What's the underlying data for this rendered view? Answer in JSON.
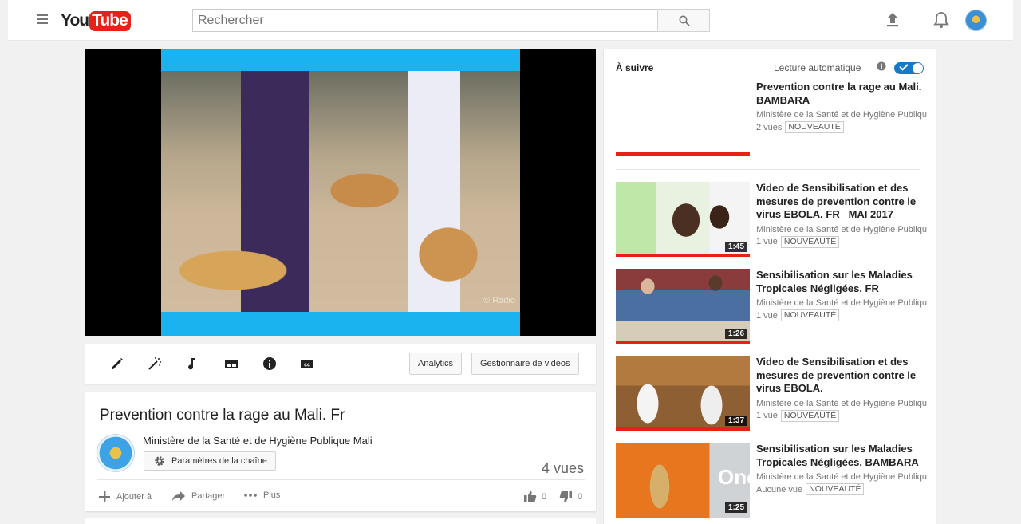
{
  "masthead": {
    "logo_you": "You",
    "logo_tube": "Tube",
    "search_placeholder": "Rechercher"
  },
  "player": {
    "watermark": "© Radio"
  },
  "toolbar": {
    "analytics_label": "Analytics",
    "video_manager_label": "Gestionnaire de vidéos"
  },
  "video": {
    "title": "Prevention contre la rage au Mali. Fr",
    "owner": "Ministère de la Santé et de Hygiène Publique Mali",
    "settings_label": "Paramètres de la chaîne",
    "views": "4 vues",
    "add_to": "Ajouter à",
    "share": "Partager",
    "more": "Plus",
    "likes": "0",
    "dislikes": "0"
  },
  "sidebar": {
    "up_next": "À suivre",
    "autoplay_label": "Lecture automatique",
    "autoplay_on": true,
    "videos": [
      {
        "title": "Prevention contre la rage au Mali. BAMBARA",
        "channel": "Ministère de la Santé et de Hygiène Publiqu",
        "views": "2 vues",
        "badge": "NOUVEAUTÉ",
        "duration": ""
      },
      {
        "title": "Video de Sensibilisation et des mesures de prevention contre le virus EBOLA. FR _MAI 2017",
        "channel": "Ministère de la Santé et de Hygiène Publiqu",
        "views": "1 vue",
        "badge": "NOUVEAUTÉ",
        "duration": "1:45"
      },
      {
        "title": "Sensibilisation sur les Maladies Tropicales Négligées. FR",
        "channel": "Ministère de la Santé et de Hygiène Publiqu",
        "views": "1 vue",
        "badge": "NOUVEAUTÉ",
        "duration": "1:26"
      },
      {
        "title": "Video de Sensibilisation et des mesures de prevention contre le virus EBOLA.",
        "channel": "Ministère de la Santé et de Hygiène Publiqu",
        "views": "1 vue",
        "badge": "NOUVEAUTÉ",
        "duration": "1:37"
      },
      {
        "title": "Sensibilisation sur les Maladies Tropicales Négligées. BAMBARA",
        "channel": "Ministère de la Santé et de Hygiène Publiqu",
        "views": "Aucune vue",
        "badge": "NOUVEAUTÉ",
        "duration": "1:25",
        "thumb_text": "Onc"
      }
    ]
  },
  "colors": {
    "brand_red": "#e62117",
    "toggle_blue": "#167ac6"
  }
}
